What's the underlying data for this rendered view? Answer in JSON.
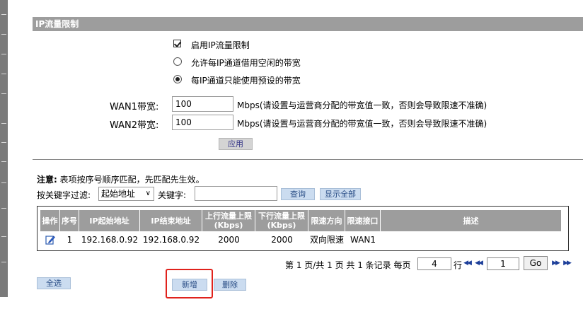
{
  "section": {
    "title": "IP流量限制"
  },
  "options": {
    "enable_label": "启用IP流量限制",
    "enable_checked": true,
    "radio_borrow_label": "允许每IP通道借用空闲的带宽",
    "radio_preset_label": "每IP通道只能使用预设的带宽",
    "selected_radio": "preset"
  },
  "wan": {
    "wan1_label": "WAN1带宽:",
    "wan1_value": "100",
    "wan2_label": "WAN2带宽:",
    "wan2_value": "100",
    "unit_note": "Mbps(请设置与运营商分配的带宽值一致，否则会导致限速不准确)"
  },
  "apply_button": "应用",
  "notice": {
    "bold": "注意:",
    "text": " 表项按序号顺序匹配，先匹配先生效。"
  },
  "filter": {
    "label": "按关键字过滤:",
    "select_value": "起始地址",
    "keyword_label": "关键字:",
    "keyword_value": "",
    "search_button": "查询",
    "show_all_button": "显示全部"
  },
  "table": {
    "headers": {
      "op": "操作",
      "no": "序号",
      "ip_start": "IP起始地址",
      "ip_end": "IP结束地址",
      "up_limit": "上行流量上限",
      "up_unit": "(Kbps)",
      "down_limit": "下行流量上限",
      "down_unit": "(Kbps)",
      "direction": "限速方向",
      "interface": "限速接口",
      "desc": "描述"
    },
    "rows": [
      {
        "no": "1",
        "ip_start": "192.168.0.92",
        "ip_end": "192.168.0.92",
        "up": "2000",
        "down": "2000",
        "direction": "双向限速",
        "interface": "WAN1",
        "desc": ""
      }
    ]
  },
  "pager": {
    "text_before": "第 1 页/共 1 页 共 1 条记录 每页",
    "per_page": "4",
    "row_unit": "行",
    "page_value": "1",
    "go_button": "Go"
  },
  "buttons": {
    "select_all": "全选",
    "add": "新增",
    "delete": "删除"
  },
  "colors": {
    "header_bg": "#9d9d9d",
    "button_blue": "#cbdcf0",
    "highlight": "#e0221c"
  }
}
